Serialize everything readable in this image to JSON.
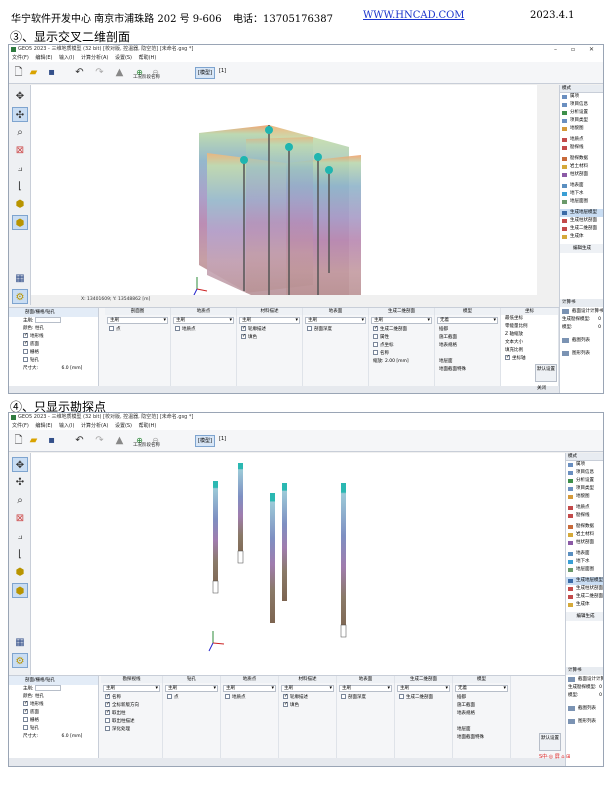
{
  "header": {
    "org": "华宁软件开发中心  南京市浦珠路  202 号  9-606",
    "phone": "电话：13705176387",
    "url": "WWW.HNCAD.COM",
    "date": "2023.4.1"
  },
  "sections": [
    {
      "title": "③、显示交叉二维剖面"
    },
    {
      "title": "④、只显示勘探点"
    }
  ],
  "window": {
    "title": "GEO5 2023 - 三维地质模型 (32 bit) [校对版, 控温器, 隐空范] [未命名.gsg *]",
    "menu": [
      "文件(F)",
      "编辑(E)",
      "输入(I)",
      "计算分析(A)",
      "设置(S)",
      "帮助(H)"
    ],
    "winctl": [
      "–",
      "▫",
      "✕"
    ],
    "toolbar": {
      "mode_label": "[模型]",
      "stage_num": "[1]",
      "stage_name": "工况阶段名称"
    }
  },
  "canvas": {
    "coords": "X: 13401609; Y: 13548862 [m]"
  },
  "right_panel": {
    "head": "模式",
    "items": [
      "属项",
      "项目信息",
      "分析设置",
      "项目类型",
      "地貌图",
      "地质点",
      "勘探线",
      "勘探数据",
      "岩土材料",
      "柱状剖面",
      "地表面",
      "地下水",
      "地层面图",
      "生成地层模型",
      "生成柱状剖面",
      "生成二维剖面",
      "生成体"
    ],
    "active_index": 13,
    "edit_label": "编辑生成"
  },
  "bottom_left": {
    "head": "剖面/栅格/钻孔",
    "rows": [
      {
        "label": "主刷:",
        "value": ""
      },
      {
        "label": "颜色:",
        "value": "柱孔"
      },
      {
        "label": "地形线",
        "checked": true
      },
      {
        "label": "底面",
        "checked": true
      },
      {
        "label": "栅格",
        "checked": false
      },
      {
        "label": "钻孔",
        "checked": false
      },
      {
        "label": "尺寸大:",
        "value": "6.0",
        "unit": "[mm]"
      }
    ]
  },
  "bottom_cols": {
    "win1": [
      {
        "head": "剖面图",
        "sel": "主刷",
        "rows": [
          "点"
        ]
      },
      {
        "head": "地质点",
        "sel": "主刷",
        "rows": [
          "地质点"
        ]
      },
      {
        "head": "材料描述",
        "sel": "主刷",
        "rows": [
          "轮廓描述",
          "填色"
        ]
      },
      {
        "head": "地表面",
        "sel": "主刷",
        "rows": [
          "剖面深度"
        ]
      },
      {
        "head": "生成二维剖面",
        "sel": "主刷",
        "rows": [
          "生成二维剖面",
          "属性",
          "点坐标",
          "名称",
          "缩放:  2.00  [mm]"
        ]
      },
      {
        "head": "模型",
        "sel": "无着",
        "rows": [
          "插都",
          "施工截面",
          "地表规格",
          "",
          "地层面",
          "地面截面特殊"
        ]
      },
      {
        "head": "坐标",
        "sel": "",
        "rows": [
          "最低坐标",
          "零能量比例",
          "Z 轴缩放",
          "文本大小",
          "填充比例",
          "坐标轴"
        ]
      }
    ],
    "win2": [
      {
        "head": "勘探视线",
        "sel": "主刷",
        "rows": [
          "名称",
          "全标新版方向",
          "取出柱",
          "取出柱描述",
          "深化处理"
        ]
      },
      {
        "head": "钻孔",
        "sel": "主刷",
        "rows": [
          "点"
        ]
      },
      {
        "head": "地质点",
        "sel": "主刷",
        "rows": [
          "地质点"
        ]
      },
      {
        "head": "材料描述",
        "sel": "主刷",
        "rows": [
          "轮廓描述",
          "填色"
        ]
      },
      {
        "head": "地表面",
        "sel": "主刷",
        "rows": [
          "剖面深度"
        ]
      },
      {
        "head": "生成二维剖面",
        "sel": "主刷",
        "rows": [
          "生成二维剖面"
        ]
      },
      {
        "head": "模型",
        "sel": "无着",
        "rows": [
          "插都",
          "施工截面",
          "地表规格",
          "",
          "地层面",
          "地面截面特殊"
        ]
      }
    ]
  },
  "mid_buttons": {
    "default": "默认设置",
    "close": "关闭"
  },
  "bottom_right": {
    "head": "计算书",
    "rows": [
      "截面设计计算书",
      "生成勘探模型",
      "描述",
      "截图列表",
      "图形列表"
    ],
    "kv": [
      {
        "k": "生成勘探模型:",
        "v": "0"
      },
      {
        "k": "模型:",
        "v": "0"
      }
    ],
    "extra": "截图列表"
  },
  "watermark": "S中·◎ 屏 ⌂ ⊞"
}
